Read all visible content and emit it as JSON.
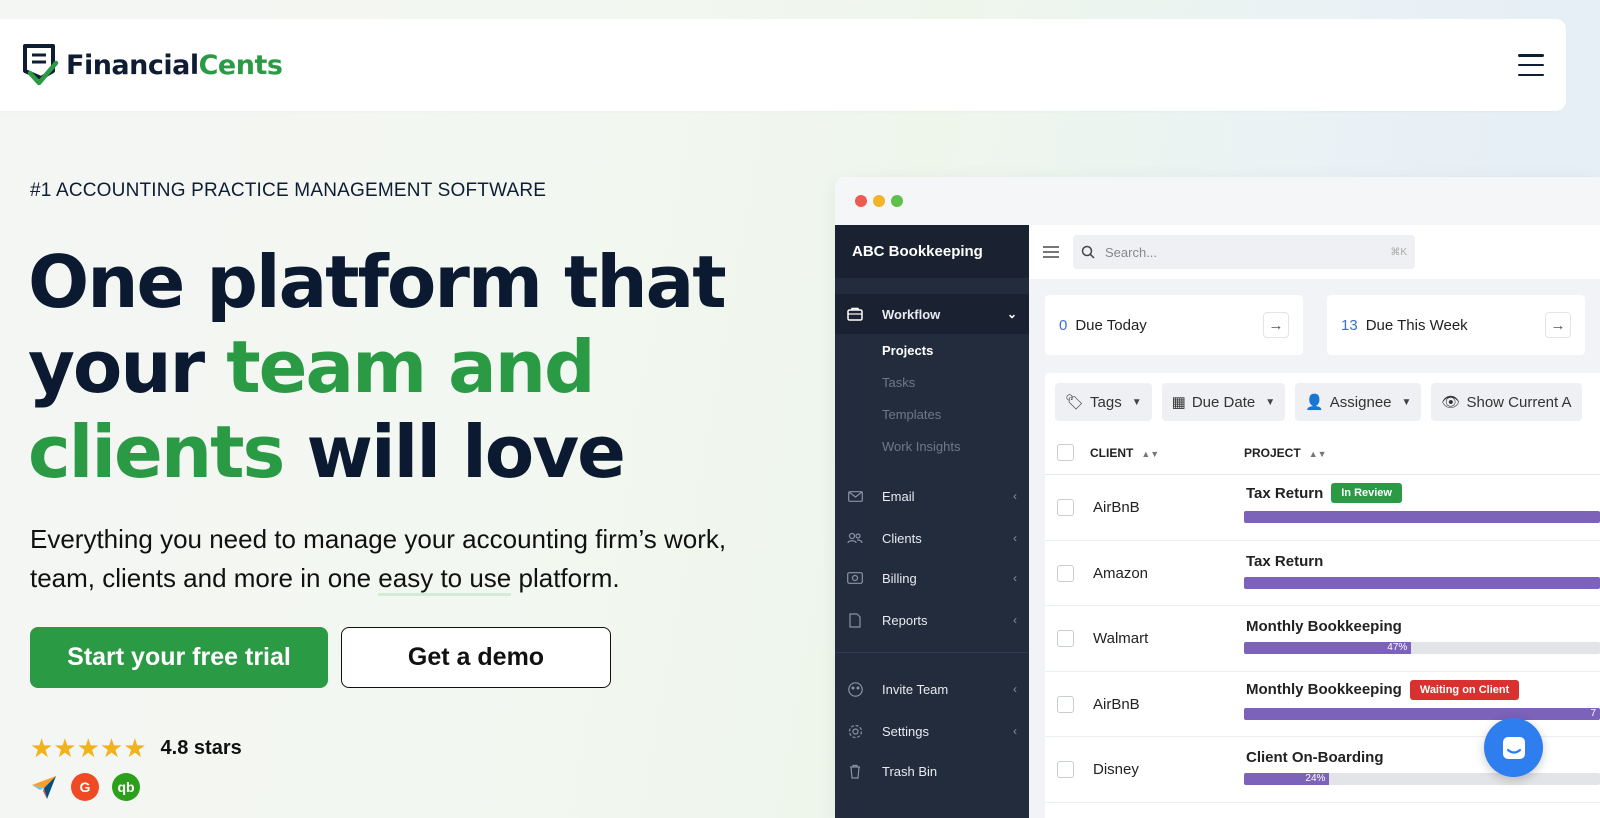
{
  "brand": {
    "name_part1": "Financial",
    "name_part2": "Cents",
    "accent": "#2b9a45",
    "dark": "#0f1d33"
  },
  "hero": {
    "eyebrow": "#1 ACCOUNTING PRACTICE MANAGEMENT SOFTWARE",
    "headline_1": "One platform that",
    "headline_2": "your ",
    "headline_2_green": "team and",
    "headline_3_green": "clients",
    "headline_3": " will love",
    "subtext_1": "Everything you need to manage your accounting firm’s work, team, clients and more in one ",
    "subtext_underline": "easy to use",
    "subtext_2": " platform.",
    "cta_primary": "Start your free trial",
    "cta_secondary": "Get a demo",
    "stars": "★★★★★",
    "rating": "4.8 stars",
    "rating_value": 4.8
  },
  "app": {
    "workspace": "ABC Bookkeeping",
    "nav": {
      "workflow": "Workflow",
      "sub": [
        "Projects",
        "Tasks",
        "Templates",
        "Work Insights"
      ],
      "email": "Email",
      "clients": "Clients",
      "billing": "Billing",
      "reports": "Reports",
      "invite": "Invite Team",
      "settings": "Settings",
      "trash": "Trash Bin"
    },
    "search_placeholder": "Search...",
    "search_shortcut": "⌘K",
    "cards": [
      {
        "num": "0",
        "label": "Due Today"
      },
      {
        "num": "13",
        "label": "Due This Week"
      }
    ],
    "filters": [
      "Tags",
      "Due Date",
      "Assignee",
      "Show Current A"
    ],
    "columns": {
      "client": "CLIENT",
      "project": "PROJECT"
    },
    "rows": [
      {
        "client": "AirBnB",
        "project": "Tax Return",
        "tag": "In Review",
        "tag_color": "#2b9a45",
        "progress": 1.0,
        "pct": ""
      },
      {
        "client": "Amazon",
        "project": "Tax Return",
        "tag": "",
        "tag_color": "",
        "progress": 1.0,
        "pct": ""
      },
      {
        "client": "Walmart",
        "project": "Monthly Bookkeeping",
        "tag": "",
        "tag_color": "",
        "progress": 0.47,
        "pct": "47%"
      },
      {
        "client": "AirBnB",
        "project": "Monthly Bookkeeping",
        "tag": "Waiting on Client",
        "tag_color": "#d8312f",
        "progress": 1.0,
        "pct": "7"
      },
      {
        "client": "Disney",
        "project": "Client On-Boarding",
        "tag": "",
        "tag_color": "",
        "progress": 0.24,
        "pct": "24%"
      }
    ]
  }
}
